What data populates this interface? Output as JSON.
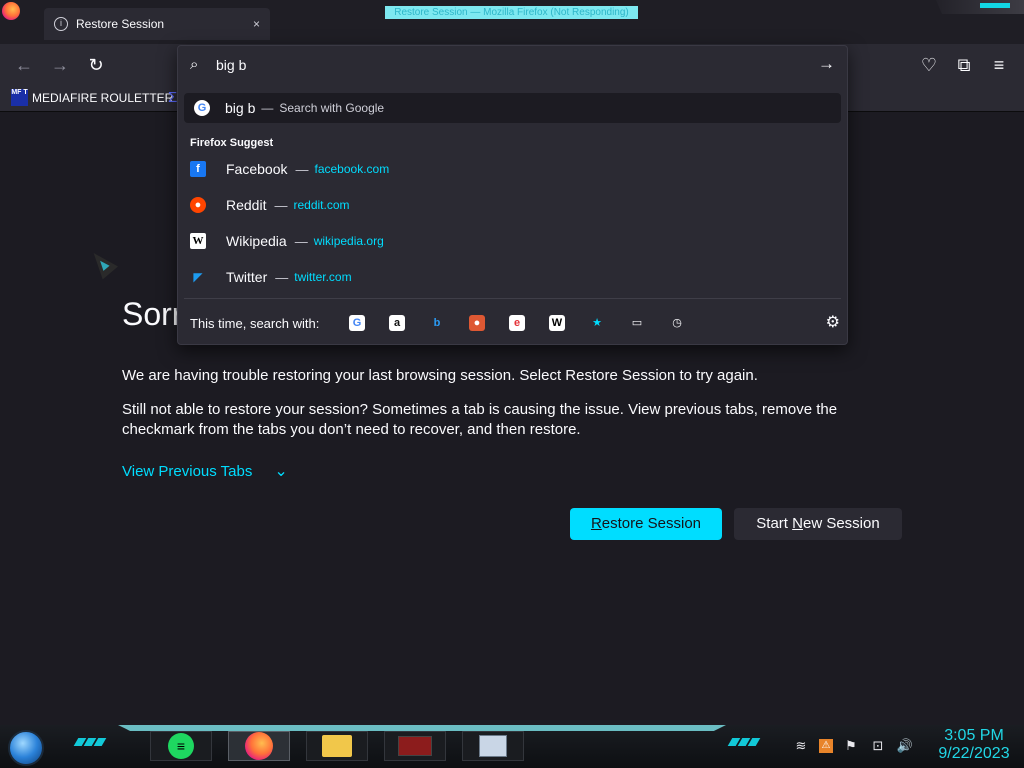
{
  "window": {
    "title": "Restore Session — Mozilla Firefox (Not Responding)"
  },
  "tab": {
    "title": "Restore Session",
    "close": "×"
  },
  "toolbar": {
    "back": "←",
    "forward": "→",
    "reload": "↻",
    "pocket": "♡",
    "extensions": "⧉",
    "menu": "≡"
  },
  "bookmarks": [
    {
      "label": "MEDIAFIRE ROULETTER",
      "icon_text": "MF T"
    }
  ],
  "urlbar": {
    "value": "big b",
    "search_icon": "⌕",
    "go_icon": "→",
    "google_row": {
      "query": "big b",
      "sep": "—",
      "label": "Search with Google"
    },
    "suggest_header": "Firefox Suggest",
    "suggestions": [
      {
        "name": "Facebook",
        "dash": "—",
        "url": "facebook.com",
        "icon": "f",
        "icon_color": "#1877f2"
      },
      {
        "name": "Reddit",
        "dash": "—",
        "url": "reddit.com",
        "icon": "●",
        "icon_color": "#ff4500"
      },
      {
        "name": "Wikipedia",
        "dash": "—",
        "url": "wikipedia.org",
        "icon": "W",
        "icon_color": "#ffffff"
      },
      {
        "name": "Twitter",
        "dash": "—",
        "url": "twitter.com",
        "icon": "🐦",
        "icon_color": "#1d9bf0"
      }
    ],
    "oneoff_label": "This time, search with:",
    "engines": [
      {
        "name": "google-engine-icon",
        "glyph": "G",
        "bg": "#ffffff",
        "fg": "#4285f4"
      },
      {
        "name": "amazon-engine-icon",
        "glyph": "a",
        "bg": "#ffffff",
        "fg": "#111111"
      },
      {
        "name": "bing-engine-icon",
        "glyph": "b",
        "bg": "transparent",
        "fg": "#2b9bf4"
      },
      {
        "name": "duckduckgo-engine-icon",
        "glyph": "●",
        "bg": "#de5833",
        "fg": "#ffffff"
      },
      {
        "name": "ebay-engine-icon",
        "glyph": "e",
        "bg": "#ffffff",
        "fg": "#e53238"
      },
      {
        "name": "wikipedia-engine-icon",
        "glyph": "W",
        "bg": "#ffffff",
        "fg": "#000000"
      },
      {
        "name": "bookmarks-engine-icon",
        "glyph": "★",
        "bg": "transparent",
        "fg": "#00ddff"
      },
      {
        "name": "tabs-engine-icon",
        "glyph": "▭",
        "bg": "transparent",
        "fg": "#fbfbfe"
      },
      {
        "name": "history-engine-icon",
        "glyph": "◷",
        "bg": "transparent",
        "fg": "#fbfbfe"
      }
    ],
    "settings_icon": "⚙"
  },
  "page": {
    "heading": "Sorr",
    "para1": "We are having trouble restoring your last browsing session. Select Restore Session to try again.",
    "para2": "Still not able to restore your session? Sometimes a tab is causing the issue. View previous tabs, remove the checkmark from the tabs you don’t need to recover, and then restore.",
    "view_previous": "View Previous Tabs",
    "chevron": "⌄",
    "restore_prefix": "R",
    "restore_rest": "estore Session",
    "new_session_prefix": "Start ",
    "new_session_u": "N",
    "new_session_rest": "ew Session"
  },
  "taskbar": {
    "spotify_glyph": "≡",
    "tray": [
      "⚠",
      "⚑",
      "⊡",
      "🔊"
    ],
    "clock_time": "3:05 PM",
    "clock_date": "9/22/2023"
  },
  "colors": {
    "accent": "#00ddff",
    "page_bg": "#1c1b22",
    "toolbar_bg": "#2b2a33",
    "clock": "#21d7e6"
  }
}
